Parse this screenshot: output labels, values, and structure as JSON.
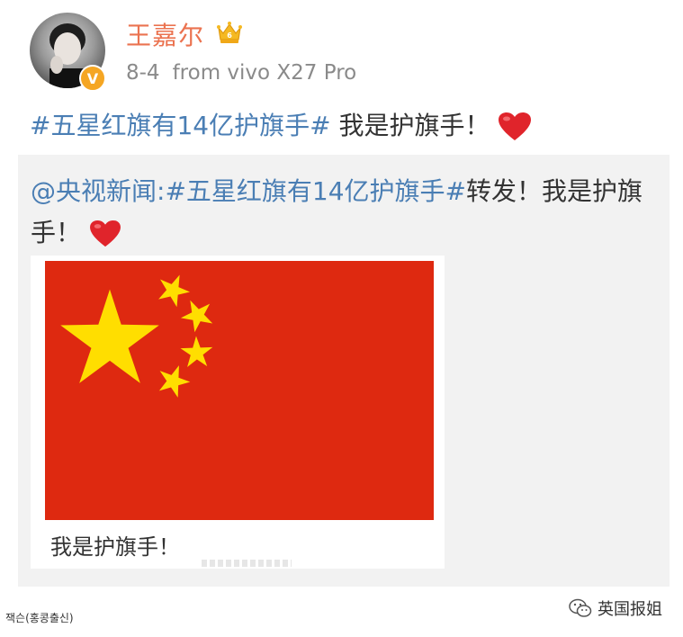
{
  "post": {
    "username": "王嘉尔",
    "date": "8-4",
    "from_label": "from",
    "device": "vivo X27 Pro",
    "hashtag": "#五星红旗有14亿护旗手#",
    "text": " 我是护旗手！",
    "verified_badge": "V"
  },
  "repost": {
    "user": "@央视新闻:",
    "hashtag": "#五星红旗有14亿护旗手#",
    "text": "转发！我是护旗手！",
    "image_caption": "我是护旗手！"
  },
  "footer": {
    "left_text": "잭슨(홍콩출신)",
    "right_text": "英国报姐"
  },
  "colors": {
    "username": "#eb7350",
    "hashtag": "#4a7eb4",
    "flag_red": "#de2910",
    "flag_yellow": "#ffde00",
    "repost_bg": "#f2f2f2"
  },
  "icons": {
    "crown": "crown-icon",
    "verified": "verified-badge-icon",
    "heart": "heart-icon",
    "wechat": "wechat-icon"
  }
}
